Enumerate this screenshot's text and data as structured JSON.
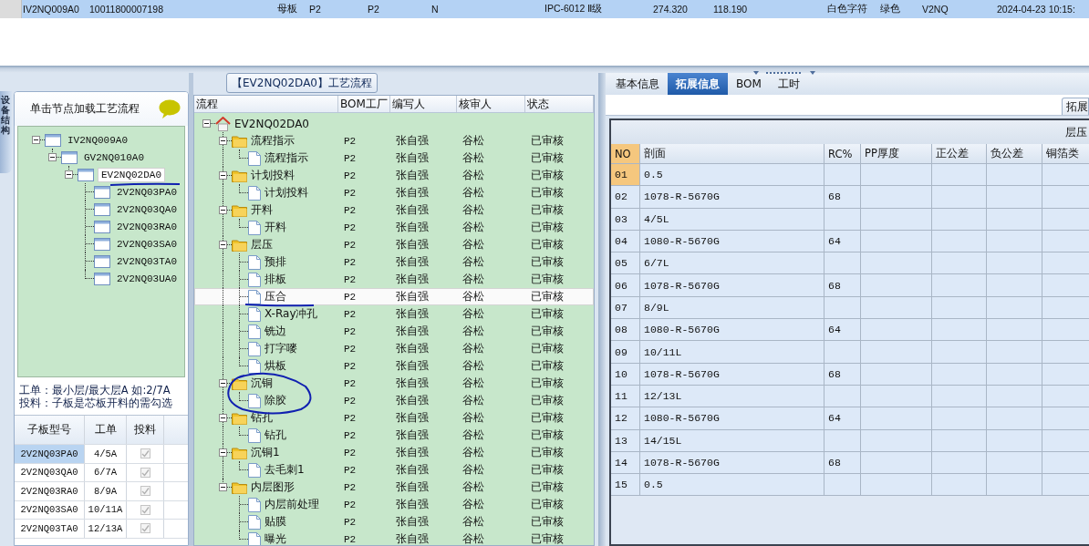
{
  "top_row": {
    "selected": true,
    "cells": [
      "IV2NQ009A0",
      "10011800007198",
      "母板",
      "P2",
      "P2",
      "N",
      "IPC-6012 Ⅱ级",
      "274.320",
      "118.190",
      "白色字符",
      "绿色",
      "V2NQ",
      "2024-04-23 10:15:"
    ]
  },
  "side_tab": {
    "label": "设备结构"
  },
  "structure": {
    "hint": "单击节点加载工艺流程",
    "tree": [
      {
        "label": "IV2NQ009A0",
        "selected": false,
        "expanded": true,
        "children": [
          {
            "label": "GV2NQ010A0",
            "selected": false,
            "expanded": true,
            "children": [
              {
                "label": "EV2NQ02DA0",
                "selected": true,
                "expanded": true,
                "children": [
                  {
                    "label": "2V2NQ03PA0",
                    "selected": false
                  },
                  {
                    "label": "2V2NQ03QA0",
                    "selected": false
                  },
                  {
                    "label": "2V2NQ03RA0",
                    "selected": false
                  },
                  {
                    "label": "2V2NQ03SA0",
                    "selected": false
                  },
                  {
                    "label": "2V2NQ03TA0",
                    "selected": false
                  },
                  {
                    "label": "2V2NQ03UA0",
                    "selected": false
                  }
                ]
              }
            ]
          }
        ]
      }
    ],
    "notes": [
      "工单：最小层/最大层A 如:2/7A",
      "投料：子板是芯板开料的需勾选"
    ],
    "columns": [
      "子板型号",
      "工单",
      "投料"
    ],
    "rows": [
      {
        "model": "2V2NQ03PA0",
        "order": "4/5A",
        "checked": true,
        "disabled": true,
        "selected": true
      },
      {
        "model": "2V2NQ03QA0",
        "order": "6/7A",
        "checked": true,
        "disabled": true,
        "selected": false
      },
      {
        "model": "2V2NQ03RA0",
        "order": "8/9A",
        "checked": true,
        "disabled": true,
        "selected": false
      },
      {
        "model": "2V2NQ03SA0",
        "order": "10/11A",
        "checked": true,
        "disabled": true,
        "selected": false
      },
      {
        "model": "2V2NQ03TA0",
        "order": "12/13A",
        "checked": true,
        "disabled": true,
        "selected": false
      }
    ]
  },
  "process": {
    "title": "【EV2NQ02DA0】工艺流程",
    "columns": [
      "流程",
      "BOM工厂",
      "编写人",
      "核审人",
      "状态"
    ],
    "tree": [
      {
        "label": "EV2NQ02DA0",
        "kind": "root",
        "selected": false,
        "expanded": true,
        "children": [
          {
            "label": "流程指示",
            "kind": "group",
            "bom": "P2",
            "writer": "张自强",
            "reviewer": "谷松",
            "status": "已审核",
            "selected": false,
            "expanded": true,
            "children": [
              {
                "label": "流程指示",
                "kind": "step",
                "bom": "P2",
                "writer": "张自强",
                "reviewer": "谷松",
                "status": "已审核",
                "selected": false
              }
            ]
          },
          {
            "label": "计划投料",
            "kind": "group",
            "bom": "P2",
            "writer": "张自强",
            "reviewer": "谷松",
            "status": "已审核",
            "selected": false,
            "expanded": true,
            "children": [
              {
                "label": "计划投料",
                "kind": "step",
                "bom": "P2",
                "writer": "张自强",
                "reviewer": "谷松",
                "status": "已审核",
                "selected": false
              }
            ]
          },
          {
            "label": "开料",
            "kind": "group",
            "bom": "P2",
            "writer": "张自强",
            "reviewer": "谷松",
            "status": "已审核",
            "selected": false,
            "expanded": true,
            "children": [
              {
                "label": "开料",
                "kind": "step",
                "bom": "P2",
                "writer": "张自强",
                "reviewer": "谷松",
                "status": "已审核",
                "selected": false
              }
            ]
          },
          {
            "label": "层压",
            "kind": "group",
            "bom": "P2",
            "writer": "张自强",
            "reviewer": "谷松",
            "status": "已审核",
            "selected": false,
            "expanded": true,
            "children": [
              {
                "label": "预排",
                "kind": "step",
                "bom": "P2",
                "writer": "张自强",
                "reviewer": "谷松",
                "status": "已审核",
                "selected": false
              },
              {
                "label": "排板",
                "kind": "step",
                "bom": "P2",
                "writer": "张自强",
                "reviewer": "谷松",
                "status": "已审核",
                "selected": false
              },
              {
                "label": "压合",
                "kind": "step",
                "bom": "P2",
                "writer": "张自强",
                "reviewer": "谷松",
                "status": "已审核",
                "selected": true
              },
              {
                "label": "X-Ray冲孔",
                "kind": "step",
                "bom": "P2",
                "writer": "张自强",
                "reviewer": "谷松",
                "status": "已审核",
                "selected": false
              },
              {
                "label": "铣边",
                "kind": "step",
                "bom": "P2",
                "writer": "张自强",
                "reviewer": "谷松",
                "status": "已审核",
                "selected": false
              },
              {
                "label": "打字嘜",
                "kind": "step",
                "bom": "P2",
                "writer": "张自强",
                "reviewer": "谷松",
                "status": "已审核",
                "selected": false
              },
              {
                "label": "烘板",
                "kind": "step",
                "bom": "P2",
                "writer": "张自强",
                "reviewer": "谷松",
                "status": "已审核",
                "selected": false
              }
            ]
          },
          {
            "label": "沉铜",
            "kind": "group",
            "bom": "P2",
            "writer": "张自强",
            "reviewer": "谷松",
            "status": "已审核",
            "selected": false,
            "expanded": true,
            "children": [
              {
                "label": "除胶",
                "kind": "step",
                "bom": "P2",
                "writer": "张自强",
                "reviewer": "谷松",
                "status": "已审核",
                "selected": false
              }
            ]
          },
          {
            "label": "钻孔",
            "kind": "group",
            "bom": "P2",
            "writer": "张自强",
            "reviewer": "谷松",
            "status": "已审核",
            "selected": false,
            "expanded": true,
            "children": [
              {
                "label": "钻孔",
                "kind": "step",
                "bom": "P2",
                "writer": "张自强",
                "reviewer": "谷松",
                "status": "已审核",
                "selected": false
              }
            ]
          },
          {
            "label": "沉铜1",
            "kind": "group",
            "bom": "P2",
            "writer": "张自强",
            "reviewer": "谷松",
            "status": "已审核",
            "selected": false,
            "expanded": true,
            "children": [
              {
                "label": "去毛刺1",
                "kind": "step",
                "bom": "P2",
                "writer": "张自强",
                "reviewer": "谷松",
                "status": "已审核",
                "selected": false
              }
            ]
          },
          {
            "label": "内层图形",
            "kind": "group",
            "bom": "P2",
            "writer": "张自强",
            "reviewer": "谷松",
            "status": "已审核",
            "selected": false,
            "expanded": true,
            "children": [
              {
                "label": "内层前处理",
                "kind": "step",
                "bom": "P2",
                "writer": "张自强",
                "reviewer": "谷松",
                "status": "已审核",
                "selected": false
              },
              {
                "label": "贴膜",
                "kind": "step",
                "bom": "P2",
                "writer": "张自强",
                "reviewer": "谷松",
                "status": "已审核",
                "selected": false
              },
              {
                "label": "曝光",
                "kind": "step",
                "bom": "P2",
                "writer": "张自强",
                "reviewer": "谷松",
                "status": "已审核",
                "selected": false
              }
            ]
          }
        ]
      }
    ]
  },
  "detail": {
    "tabs": [
      {
        "label": "基本信息",
        "selected": false
      },
      {
        "label": "拓展信息",
        "selected": true
      },
      {
        "label": "BOM",
        "selected": false
      },
      {
        "label": "工时",
        "selected": false
      }
    ],
    "subtab": {
      "label": "拓展"
    },
    "section_title": "层压",
    "columns": [
      "NO",
      "剖面",
      "RC%",
      "PP厚度",
      "正公差",
      "负公差",
      "铜箔类"
    ],
    "rows": [
      {
        "no": "01",
        "section": "0.5",
        "selected": true
      },
      {
        "no": "02",
        "section": "1078-R-5670G",
        "rc": "68",
        "selected": false
      },
      {
        "no": "03",
        "section": "4/5L",
        "selected": false
      },
      {
        "no": "04",
        "section": "1080-R-5670G",
        "rc": "64",
        "selected": false
      },
      {
        "no": "05",
        "section": "6/7L",
        "selected": false
      },
      {
        "no": "06",
        "section": "1078-R-5670G",
        "rc": "68",
        "selected": false
      },
      {
        "no": "07",
        "section": "8/9L",
        "selected": false
      },
      {
        "no": "08",
        "section": "1080-R-5670G",
        "rc": "64",
        "selected": false
      },
      {
        "no": "09",
        "section": "10/11L",
        "selected": false
      },
      {
        "no": "10",
        "section": "1078-R-5670G",
        "rc": "68",
        "selected": false
      },
      {
        "no": "11",
        "section": "12/13L",
        "selected": false
      },
      {
        "no": "12",
        "section": "1080-R-5670G",
        "rc": "64",
        "selected": false
      },
      {
        "no": "13",
        "section": "14/15L",
        "selected": false
      },
      {
        "no": "14",
        "section": "1078-R-5670G",
        "rc": "68",
        "selected": false
      },
      {
        "no": "15",
        "section": "0.5",
        "selected": false
      }
    ]
  }
}
